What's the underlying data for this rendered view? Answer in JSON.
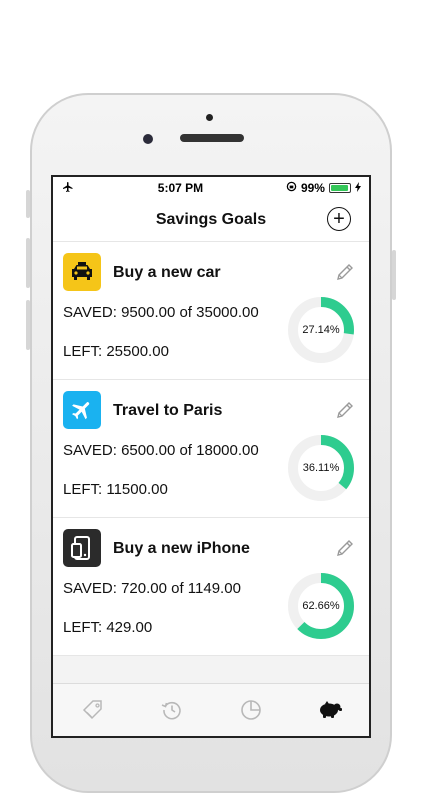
{
  "status_bar": {
    "time": "5:07 PM",
    "battery": "99%"
  },
  "nav": {
    "title": "Savings Goals",
    "add_label": "+"
  },
  "goals": [
    {
      "name": "Buy a new car",
      "icon": "taxi-icon",
      "icon_color": "#f5c518",
      "saved": "SAVED: 9500.00 of 35000.00",
      "left": "LEFT: 25500.00",
      "percent_label": "27.14%",
      "percent": 27.14
    },
    {
      "name": "Travel to Paris",
      "icon": "airplane-icon",
      "icon_color": "#1ab2f0",
      "saved": "SAVED: 6500.00 of 18000.00",
      "left": "LEFT: 11500.00",
      "percent_label": "36.11%",
      "percent": 36.11
    },
    {
      "name": "Buy a new iPhone",
      "icon": "phone-icon",
      "icon_color": "#2b2b2b",
      "saved": "SAVED: 720.00 of 1149.00",
      "left": "LEFT: 429.00",
      "percent_label": "62.66%",
      "percent": 62.66
    }
  ],
  "colors": {
    "progress": "#2ecc8f",
    "track": "#f0f0f0",
    "active_tab": "#111111",
    "inactive_tab": "#b8b8b8"
  },
  "tabs": [
    {
      "icon": "tag-icon",
      "active": false
    },
    {
      "icon": "history-icon",
      "active": false
    },
    {
      "icon": "pie-chart-icon",
      "active": false
    },
    {
      "icon": "piggy-bank-icon",
      "active": true
    }
  ]
}
